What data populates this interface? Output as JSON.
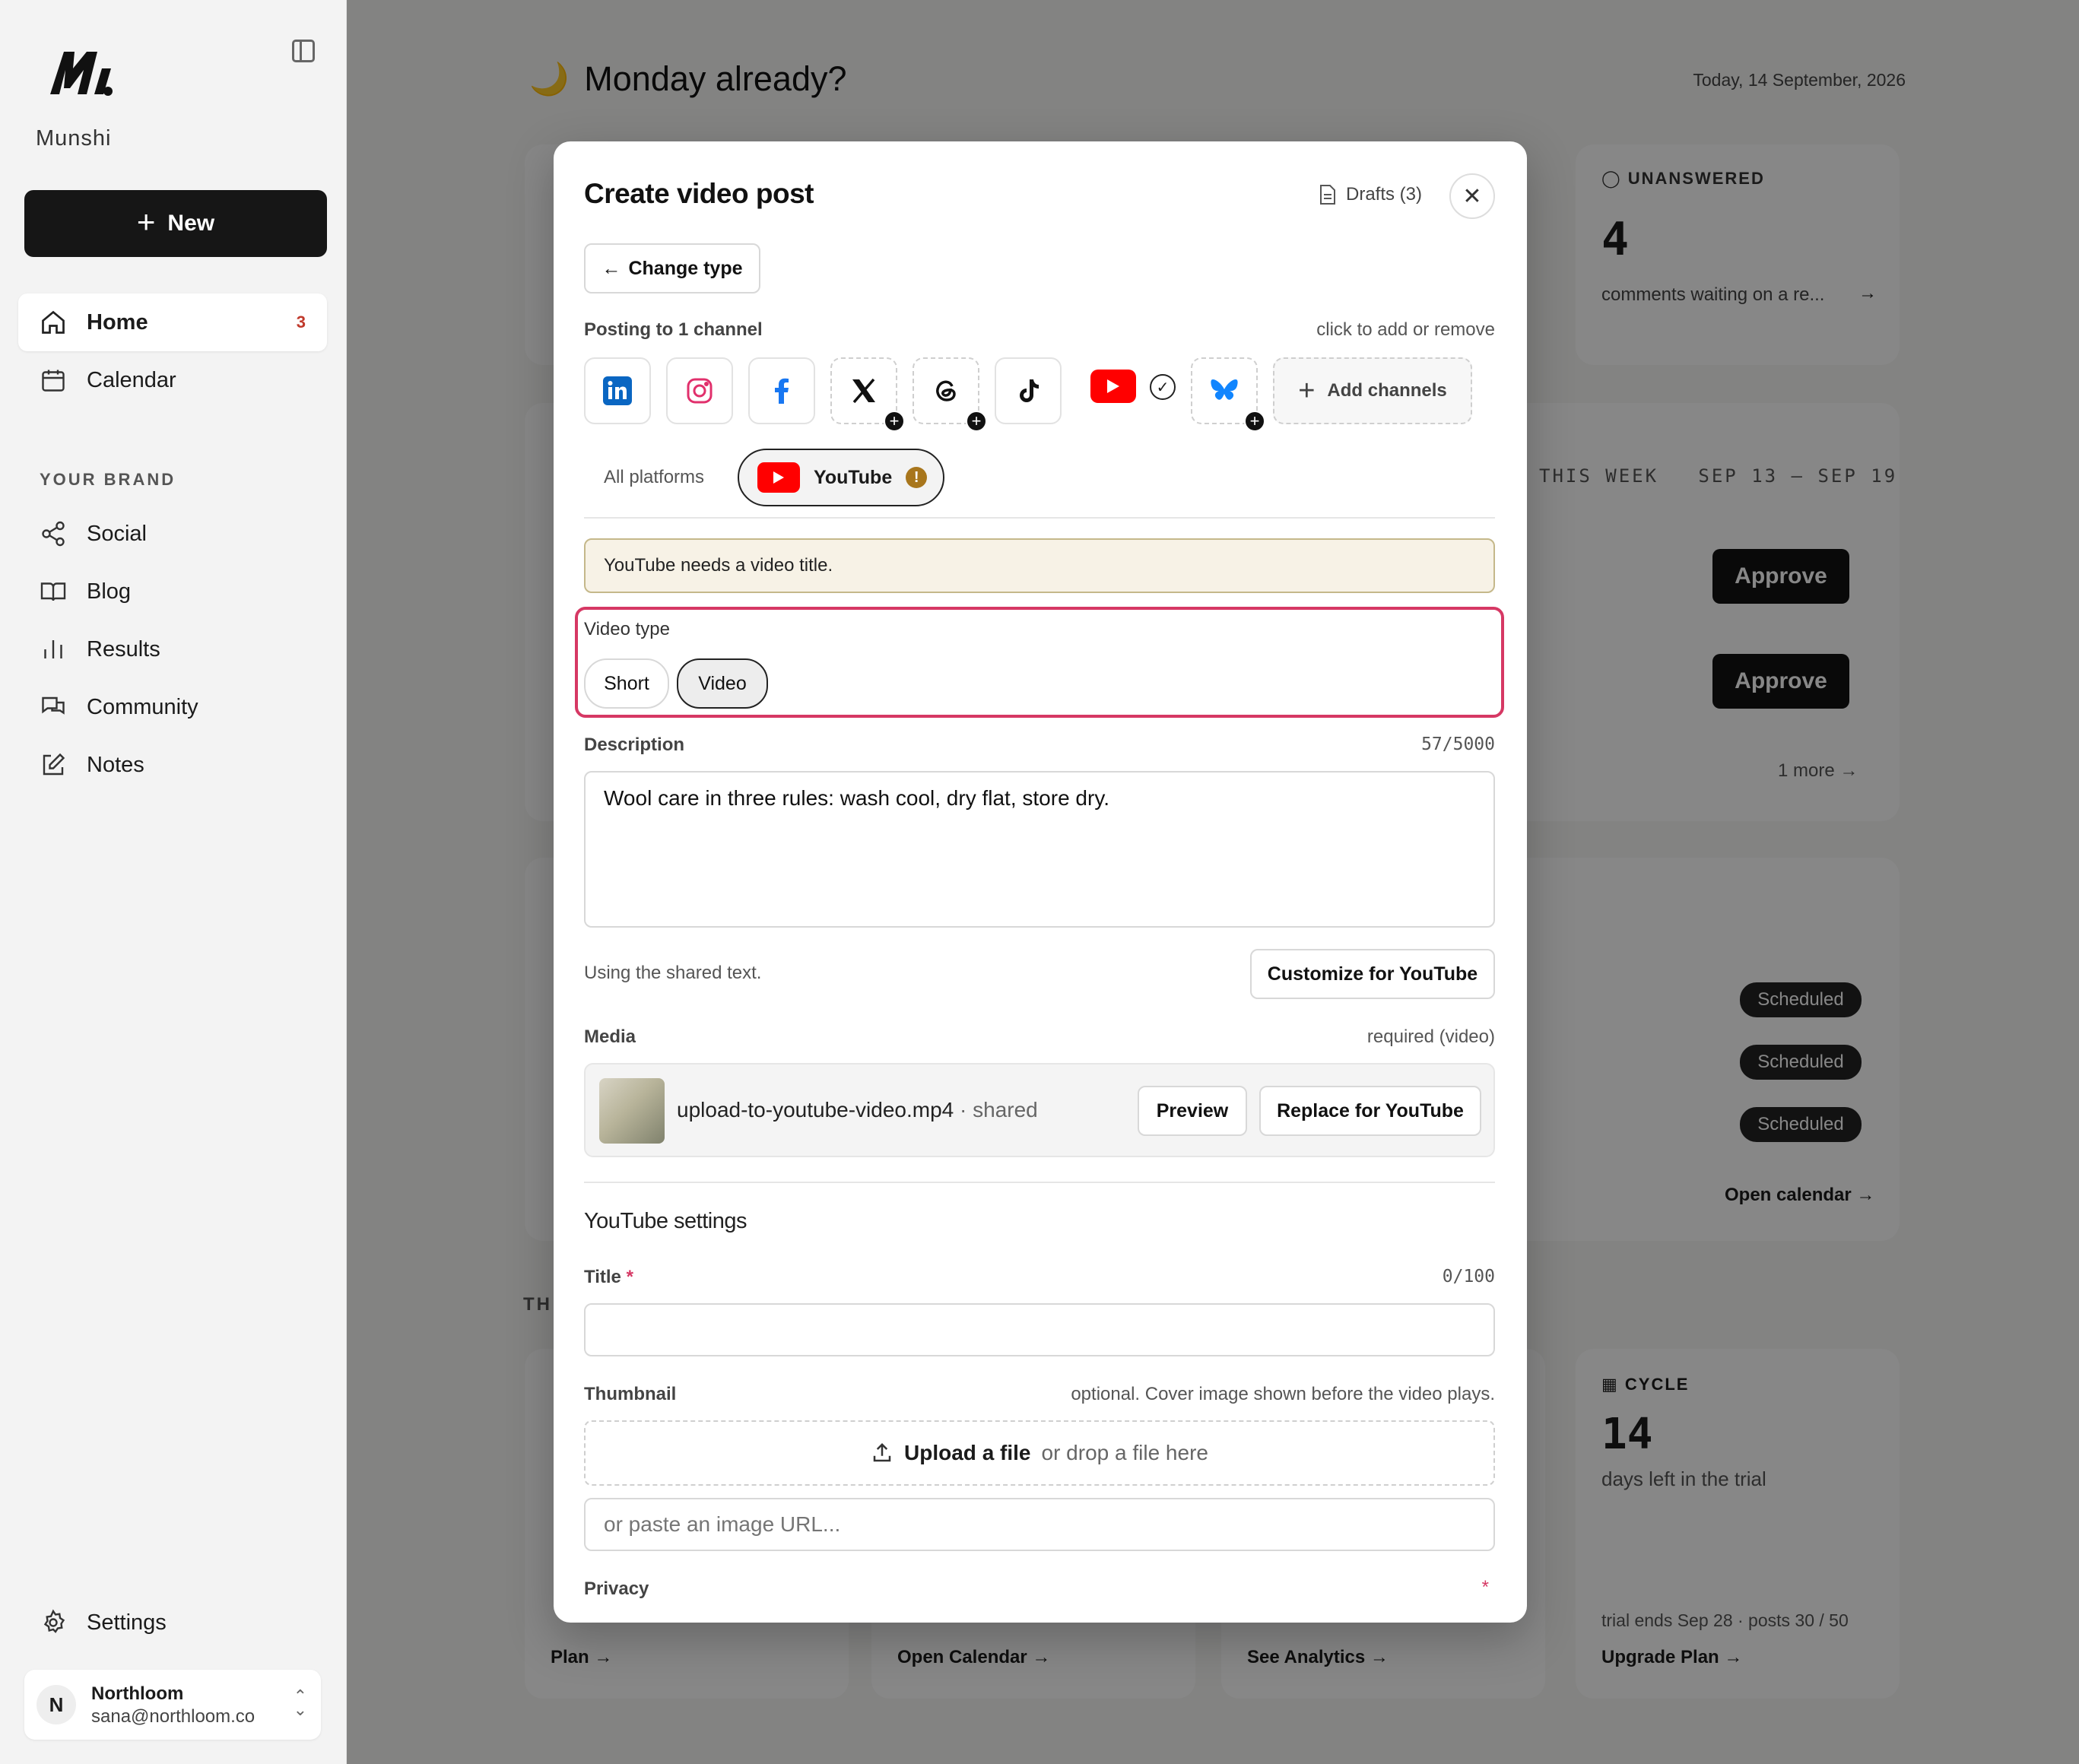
{
  "app": {
    "brand": "Munshi",
    "new_label": "New",
    "nav": [
      {
        "label": "Home",
        "badge": "3"
      },
      {
        "label": "Calendar"
      }
    ],
    "section_label": "YOUR BRAND",
    "brand_nav": [
      {
        "label": "Social"
      },
      {
        "label": "Blog"
      },
      {
        "label": "Results"
      },
      {
        "label": "Community"
      },
      {
        "label": "Notes"
      }
    ],
    "settings_label": "Settings",
    "account": {
      "initial": "N",
      "name": "Northloom",
      "email": "sana@northloom.co"
    }
  },
  "dashboard": {
    "greeting": "Monday already?",
    "date": "Today, 14 September, 2026",
    "unanswered": {
      "label": "UNANSWERED",
      "count": "4",
      "desc": "comments waiting on a re..."
    },
    "week": {
      "label": "THIS WEEK",
      "range": "SEP 13 – SEP 19",
      "approve": "Approve",
      "more": "1 more"
    },
    "scheduled_label": "Scheduled",
    "open_calendar": "Open calendar →",
    "section_partial": "TH",
    "cycle": {
      "label": "CYCLE",
      "count": "14",
      "desc": "days left in the trial",
      "foot": "trial ends Sep 28 · posts 30 / 50",
      "link": "Upgrade Plan →"
    },
    "bottom_links": [
      "Plan →",
      "Open Calendar →",
      "See Analytics →"
    ]
  },
  "modal": {
    "title": "Create video post",
    "drafts": "Drafts (3)",
    "change_type": "Change type",
    "posting_to": "Posting to 1 channel",
    "add_hint": "click to add or remove",
    "add_channels": "Add channels",
    "tabs": {
      "all": "All platforms",
      "youtube": "YouTube"
    },
    "warning": "YouTube needs a video title.",
    "video_type": {
      "label": "Video type",
      "options": [
        "Short",
        "Video"
      ],
      "selected": "Video"
    },
    "description": {
      "label": "Description",
      "count": "57/5000",
      "value": "Wool care in three rules: wash cool, dry flat, store dry."
    },
    "shared_text": "Using the shared text.",
    "customize": "Customize for YouTube",
    "media": {
      "label": "Media",
      "hint": "required (video)",
      "file": "upload-to-youtube-video.mp4",
      "tag": "· shared",
      "preview": "Preview",
      "replace": "Replace for YouTube"
    },
    "settings_title": "YouTube settings",
    "title_field": {
      "label": "Title",
      "required": "*",
      "count": "0/100",
      "value": ""
    },
    "thumbnail": {
      "label": "Thumbnail",
      "hint": "optional. Cover image shown before the video plays.",
      "upload": "Upload a file",
      "drop": "or drop a file here",
      "url_placeholder": "or paste an image URL..."
    },
    "privacy": {
      "label": "Privacy",
      "required": "*"
    }
  },
  "colors": {
    "accent_highlight": "#d63864",
    "youtube_red": "#ff0000",
    "warning_bg": "#f7f2e6"
  }
}
